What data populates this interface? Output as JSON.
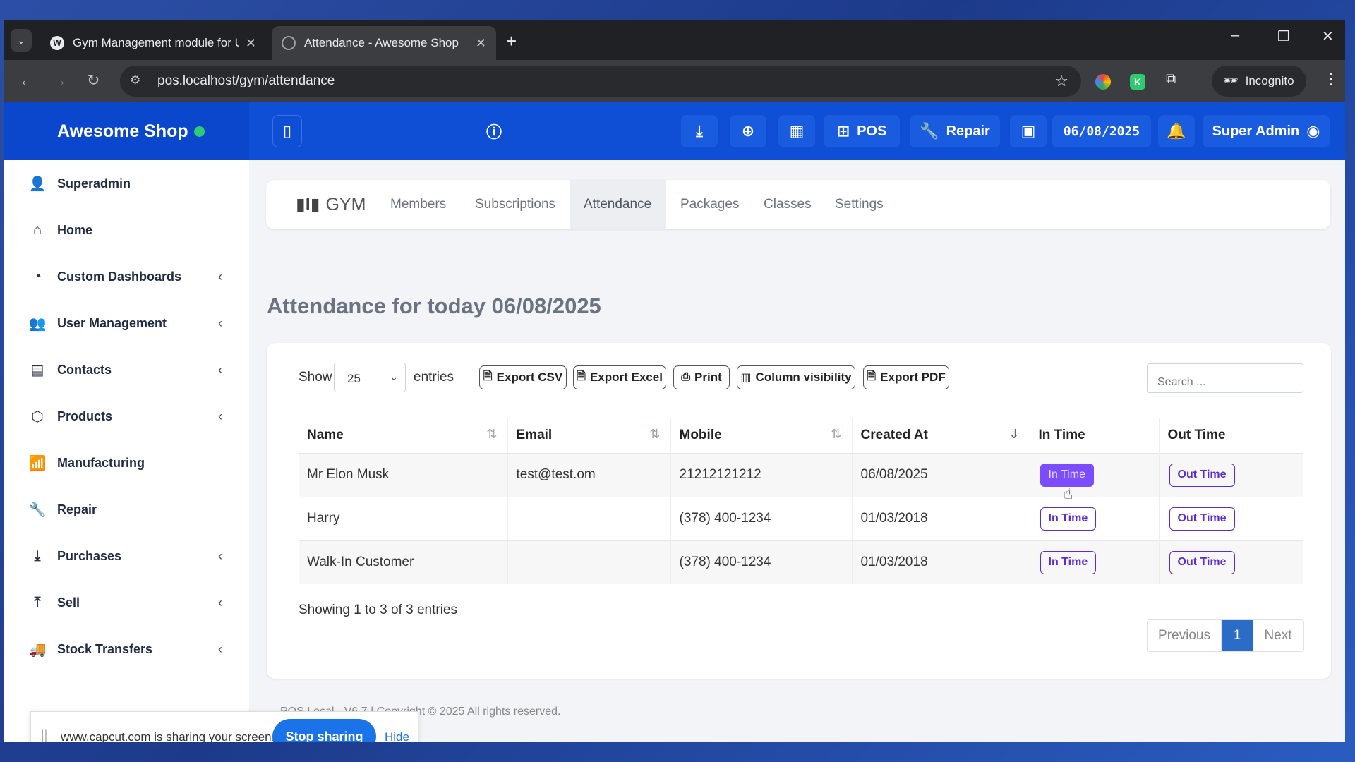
{
  "browser": {
    "tabs": [
      {
        "title": "Gym Management module for U"
      },
      {
        "title": "Attendance - Awesome Shop"
      }
    ],
    "url": "pos.localhost/gym/attendance",
    "incognito_label": "Incognito"
  },
  "header": {
    "brand": "Awesome Shop",
    "pos_label": "POS",
    "repair_label": "Repair",
    "date": "06/08/2025",
    "user": "Super Admin"
  },
  "sidebar": {
    "items": [
      {
        "label": "Superadmin",
        "icon": "user-cog-icon"
      },
      {
        "label": "Home",
        "icon": "home-icon"
      },
      {
        "label": "Custom Dashboards",
        "icon": "dashboard-icon"
      },
      {
        "label": "User Management",
        "icon": "users-icon"
      },
      {
        "label": "Contacts",
        "icon": "contacts-icon"
      },
      {
        "label": "Products",
        "icon": "box-icon"
      },
      {
        "label": "Manufacturing",
        "icon": "chart-icon"
      },
      {
        "label": "Repair",
        "icon": "wrench-icon"
      },
      {
        "label": "Purchases",
        "icon": "download-icon"
      },
      {
        "label": "Sell",
        "icon": "upload-icon"
      },
      {
        "label": "Stock Transfers",
        "icon": "truck-icon"
      }
    ]
  },
  "gymnav": {
    "brand": "GYM",
    "items": [
      "Members",
      "Subscriptions",
      "Attendance",
      "Packages",
      "Classes",
      "Settings"
    ],
    "active": "Attendance"
  },
  "page": {
    "title": "Attendance for today 06/08/2025",
    "show_label": "Show",
    "entries_value": "25",
    "entries_label": "entries",
    "export_buttons": [
      "Export CSV",
      "Export Excel",
      "Print",
      "Column visibility",
      "Export PDF"
    ],
    "search_placeholder": "Search ...",
    "columns": [
      "Name",
      "Email",
      "Mobile",
      "Created At",
      "In Time",
      "Out Time"
    ],
    "rows": [
      {
        "name": "Mr Elon Musk",
        "email": "test@test.om",
        "mobile": "21212121212",
        "created_at": "06/08/2025",
        "in": "In Time",
        "out": "Out Time"
      },
      {
        "name": "Harry",
        "email": "",
        "mobile": "(378) 400-1234",
        "created_at": "01/03/2018",
        "in": "In Time",
        "out": "Out Time"
      },
      {
        "name": "Walk-In Customer",
        "email": "",
        "mobile": "(378) 400-1234",
        "created_at": "01/03/2018",
        "in": "In Time",
        "out": "Out Time"
      }
    ],
    "showing": "Showing 1 to 3 of 3 entries",
    "pager": {
      "prev": "Previous",
      "current": "1",
      "next": "Next"
    },
    "footer": "POS Local - V6.7 | Copyright © 2025 All rights reserved."
  },
  "share_bar": {
    "message": "www.capcut.com is sharing your screen.",
    "stop": "Stop sharing",
    "hide": "Hide"
  },
  "colors": {
    "header_blue": "#0f4fd6",
    "accent_purple": "#5b2bd6",
    "pager_active": "#2b6dc6",
    "chrome_blue": "#1a73e8"
  }
}
